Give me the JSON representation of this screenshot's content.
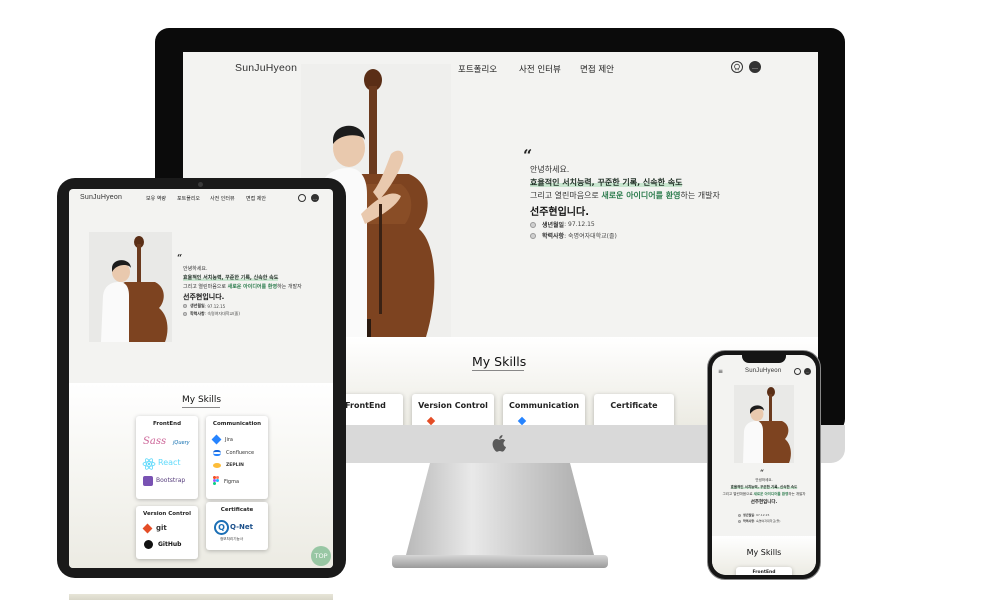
{
  "site": {
    "logo": "SunJuHyeon",
    "nav": [
      "보유 역량",
      "포트폴리오",
      "사전 인터뷰",
      "면접 제안"
    ],
    "icons": [
      "github-icon",
      "chat-icon"
    ],
    "chat_icon_text": "…"
  },
  "intro": {
    "quote": "“",
    "greeting": "안녕하세요.",
    "line1": "효율적인 서치능력, 꾸준한 기록, 신속한 속도",
    "line2_pre": "그리고 열린마음으로 ",
    "line2_highlight": "새로운 아이디어를 환영",
    "line2_post": "하는 개발자",
    "name": "선주현입니다.",
    "birth_label": "생년월일",
    "birth_value": " : 97.12.15",
    "school_label": "학력사항",
    "school_value": " : 숙명여자대학교(졸)"
  },
  "skills": {
    "title": "My Skills",
    "cards": [
      "FrontEnd",
      "Version Control",
      "Communication",
      "Certificate"
    ],
    "frontend_tools": [
      "Sass",
      "jQuery",
      "React",
      "Bootstrap"
    ],
    "communication_tools": [
      "Jira",
      "Confluence",
      "ZEPLIN",
      "Figma"
    ],
    "version_tools": [
      "git",
      "GitHub"
    ],
    "certificate_name": "Q-Net",
    "certificate_sub": "정보처리기능사",
    "certificate_mark": "Q"
  },
  "menu_icon": "≡",
  "top_button": "TOP",
  "colors": {
    "accent_green": "#2e7d4f",
    "highlight": "#c8e6cf",
    "top_button": "#8fc39d"
  }
}
